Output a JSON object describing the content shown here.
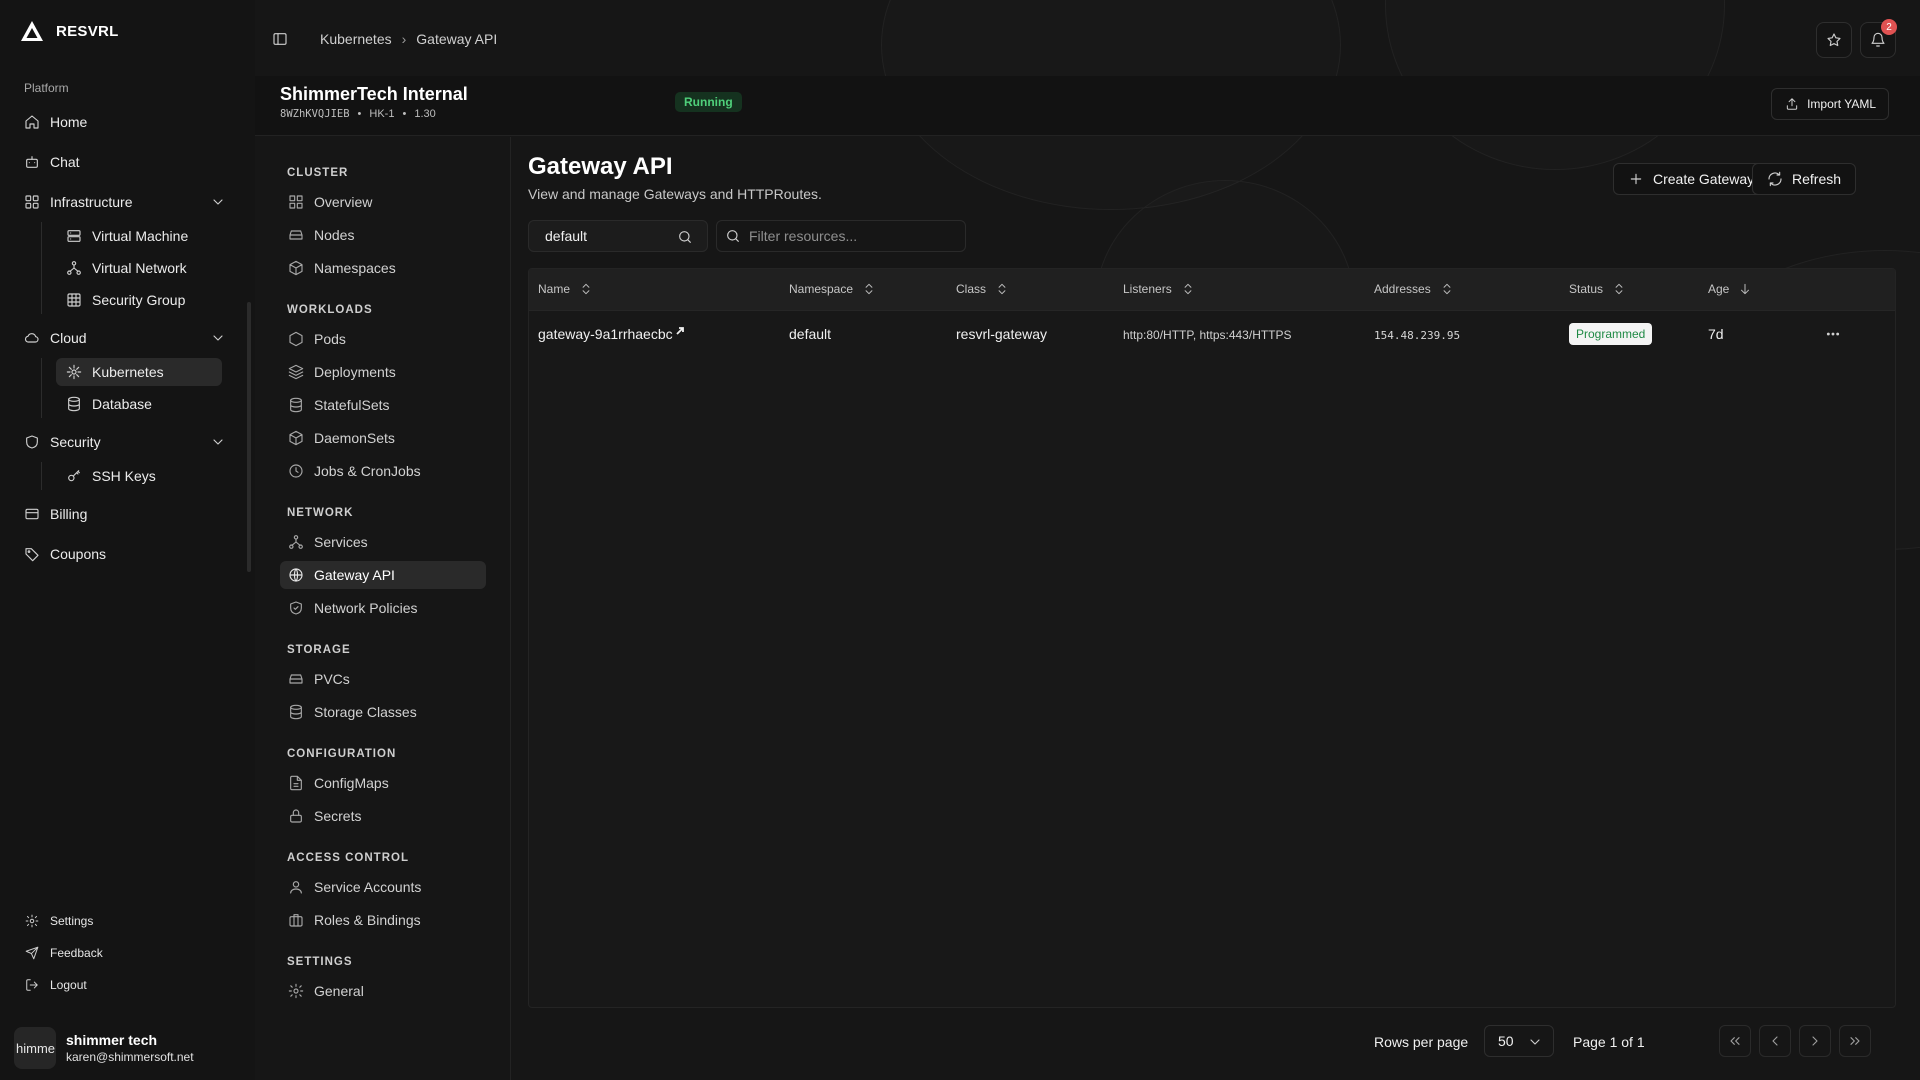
{
  "app": {
    "brand": "RESVRL",
    "group_label": "Platform"
  },
  "sidebar": {
    "items": [
      {
        "label": "Home",
        "icon": "home-icon"
      },
      {
        "label": "Chat",
        "icon": "chat-icon"
      },
      {
        "label": "Infrastructure",
        "icon": "infrastructure-icon",
        "expanded": true,
        "children": [
          {
            "label": "Virtual Machine",
            "icon": "server-icon"
          },
          {
            "label": "Virtual Network",
            "icon": "network-icon"
          },
          {
            "label": "Security Group",
            "icon": "grid-icon"
          }
        ]
      },
      {
        "label": "Cloud",
        "icon": "cloud-icon",
        "expanded": true,
        "children": [
          {
            "label": "Kubernetes",
            "icon": "kubernetes-icon",
            "active": true
          },
          {
            "label": "Database",
            "icon": "database-icon"
          }
        ]
      },
      {
        "label": "Security",
        "icon": "shield-icon",
        "expanded": true,
        "children": [
          {
            "label": "SSH Keys",
            "icon": "key-icon"
          }
        ]
      },
      {
        "label": "Billing",
        "icon": "card-icon"
      },
      {
        "label": "Coupons",
        "icon": "tag-icon"
      }
    ],
    "footer": [
      {
        "label": "Settings",
        "icon": "gear-icon"
      },
      {
        "label": "Feedback",
        "icon": "send-icon"
      },
      {
        "label": "Logout",
        "icon": "logout-icon"
      }
    ],
    "user": {
      "avatar_text": "himme",
      "name": "shimmer tech",
      "email": "karen@shimmersoft.net"
    }
  },
  "header": {
    "breadcrumb": [
      "Kubernetes",
      "Gateway API"
    ],
    "notification_count": "2"
  },
  "cluster": {
    "name": "ShimmerTech Internal",
    "id": "8WZhKVQJIEB",
    "region": "HK-1",
    "version": "1.30",
    "status": "Running",
    "status_color": "#4fd07a",
    "import_label": "Import YAML"
  },
  "resource_nav": {
    "sections": [
      {
        "title": "CLUSTER",
        "items": [
          {
            "label": "Overview",
            "icon": "overview-icon"
          },
          {
            "label": "Nodes",
            "icon": "nodes-icon"
          },
          {
            "label": "Namespaces",
            "icon": "box-icon"
          }
        ]
      },
      {
        "title": "WORKLOADS",
        "items": [
          {
            "label": "Pods",
            "icon": "pod-icon"
          },
          {
            "label": "Deployments",
            "icon": "layers-icon"
          },
          {
            "label": "StatefulSets",
            "icon": "database-icon"
          },
          {
            "label": "DaemonSets",
            "icon": "box-icon"
          },
          {
            "label": "Jobs & CronJobs",
            "icon": "clock-icon"
          }
        ]
      },
      {
        "title": "NETWORK",
        "items": [
          {
            "label": "Services",
            "icon": "network-icon"
          },
          {
            "label": "Gateway API",
            "icon": "globe-icon",
            "active": true
          },
          {
            "label": "Network Policies",
            "icon": "shield-check-icon"
          }
        ]
      },
      {
        "title": "STORAGE",
        "items": [
          {
            "label": "PVCs",
            "icon": "drive-icon"
          },
          {
            "label": "Storage Classes",
            "icon": "database-icon"
          }
        ]
      },
      {
        "title": "CONFIGURATION",
        "items": [
          {
            "label": "ConfigMaps",
            "icon": "file-icon"
          },
          {
            "label": "Secrets",
            "icon": "lock-icon"
          }
        ]
      },
      {
        "title": "ACCESS CONTROL",
        "items": [
          {
            "label": "Service Accounts",
            "icon": "user-icon"
          },
          {
            "label": "Roles & Bindings",
            "icon": "briefcase-icon"
          }
        ]
      },
      {
        "title": "SETTINGS",
        "items": [
          {
            "label": "General",
            "icon": "gear-icon"
          }
        ]
      }
    ]
  },
  "page": {
    "title": "Gateway API",
    "subtitle": "View and manage Gateways and HTTPRoutes.",
    "create_label": "Create Gateway",
    "refresh_label": "Refresh",
    "namespace_value": "default",
    "filter_placeholder": "Filter resources..."
  },
  "table": {
    "columns": [
      "Name",
      "Namespace",
      "Class",
      "Listeners",
      "Addresses",
      "Status",
      "Age"
    ],
    "rows": [
      {
        "name": "gateway-9a1rrhaecbc",
        "namespace": "default",
        "class": "resvrl-gateway",
        "listeners": "http:80/HTTP, https:443/HTTPS",
        "addresses": "154.48.239.95",
        "status": "Programmed",
        "age": "7d"
      }
    ]
  },
  "pagination": {
    "rows_per_page_label": "Rows per page",
    "rows_per_page": "50",
    "page_label": "Page 1 of 1"
  }
}
